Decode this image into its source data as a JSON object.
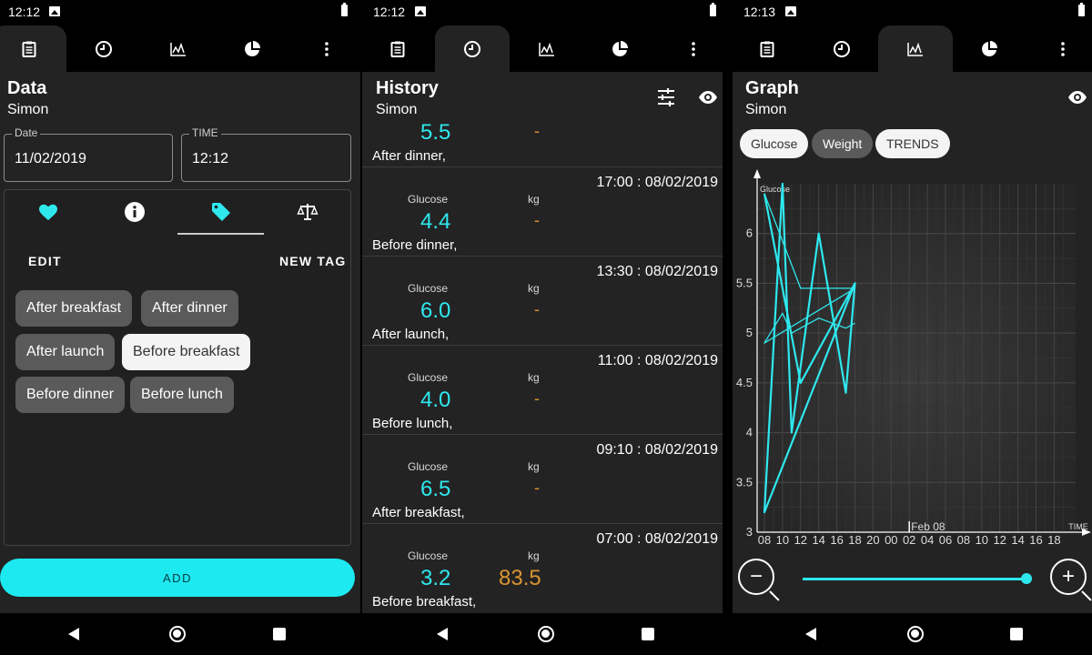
{
  "icons": {
    "tabs": [
      "data-entry-icon",
      "history-clock-icon",
      "graph-icon",
      "pie-chart-icon",
      "more-vert-icon"
    ],
    "status": [
      "image-notification-icon",
      "battery-icon"
    ],
    "nav": [
      "back-icon",
      "home-icon",
      "recents-icon"
    ]
  },
  "colors": {
    "accent": "#1de9f0",
    "glucose": "#2ee8ee",
    "weight": "#d99532",
    "background": "#232323"
  },
  "data_screen": {
    "status_time": "12:12",
    "active_tab": 0,
    "title": "Data",
    "user": "Simon",
    "date_label": "Date",
    "date_value": "11/02/2019",
    "time_label": "TIME",
    "time_value": "12:12",
    "card_tabs": [
      "heart-icon",
      "info-icon",
      "tag-icon",
      "scale-icon"
    ],
    "active_card_tab": 2,
    "edit_label": "EDIT",
    "new_tag_label": "NEW TAG",
    "tags": [
      {
        "label": "After breakfast",
        "selected": false
      },
      {
        "label": "After dinner",
        "selected": false
      },
      {
        "label": "After launch",
        "selected": false
      },
      {
        "label": "Before breakfast",
        "selected": true
      },
      {
        "label": "Before dinner",
        "selected": false
      },
      {
        "label": "Before lunch",
        "selected": false
      }
    ],
    "add_label": "ADD"
  },
  "history_screen": {
    "status_time": "12:12",
    "active_tab": 1,
    "title": "History",
    "user": "Simon",
    "header_icons": [
      "filter-sliders-icon",
      "visibility-eye-icon"
    ],
    "entries": [
      {
        "time": "",
        "glucose_label": "",
        "kg_label": "",
        "glucose": "5.5",
        "kg": "-",
        "tag": "After dinner,"
      },
      {
        "time": "17:00 : 08/02/2019",
        "glucose_label": "Glucose",
        "kg_label": "kg",
        "glucose": "4.4",
        "kg": "-",
        "tag": "Before dinner,"
      },
      {
        "time": "13:30 : 08/02/2019",
        "glucose_label": "Glucose",
        "kg_label": "kg",
        "glucose": "6.0",
        "kg": "-",
        "tag": "After launch,"
      },
      {
        "time": "11:00 : 08/02/2019",
        "glucose_label": "Glucose",
        "kg_label": "kg",
        "glucose": "4.0",
        "kg": "-",
        "tag": "Before lunch,"
      },
      {
        "time": "09:10 : 08/02/2019",
        "glucose_label": "Glucose",
        "kg_label": "kg",
        "glucose": "6.5",
        "kg": "-",
        "tag": "After breakfast,"
      },
      {
        "time": "07:00 : 08/02/2019",
        "glucose_label": "Glucose",
        "kg_label": "kg",
        "glucose": "3.2",
        "kg": "83.5",
        "tag": "Before breakfast,"
      }
    ]
  },
  "graph_screen": {
    "status_time": "12:13",
    "active_tab": 2,
    "title": "Graph",
    "user": "Simon",
    "header_icons": [
      "visibility-eye-icon"
    ],
    "chips": [
      {
        "label": "Glucose",
        "style": "light"
      },
      {
        "label": "Weight",
        "style": "dark"
      },
      {
        "label": "TRENDS",
        "style": "light"
      }
    ],
    "zoom_out": "−",
    "zoom_in": "+",
    "zoom_level": 1.0
  },
  "chart_data": {
    "type": "line",
    "title": "",
    "ylabel": "Glucose",
    "xlabel": "TIME",
    "ylim": [
      3,
      6.5
    ],
    "yticks": [
      "3",
      "3.5",
      "4",
      "4.5",
      "5",
      "5.5",
      "6"
    ],
    "xticks": [
      "08",
      "10",
      "12",
      "14",
      "16",
      "18",
      "20",
      "00",
      "02",
      "04",
      "06",
      "08",
      "10",
      "12",
      "14",
      "16",
      "18"
    ],
    "date_marker": "Feb 08",
    "grid": true,
    "legend": "none",
    "series": [
      {
        "x": [
          "08",
          "12",
          "18",
          "08",
          "10",
          "11",
          "14",
          "17",
          "18"
        ],
        "values": [
          6.4,
          4.5,
          5.5,
          3.2,
          6.5,
          4.0,
          6.0,
          4.4,
          5.5
        ]
      },
      {
        "x": [
          "08",
          "12",
          "18",
          "08",
          "10",
          "11",
          "14",
          "17",
          "18"
        ],
        "values": [
          6.4,
          5.45,
          5.45,
          4.9,
          5.2,
          5.0,
          5.15,
          5.05,
          5.1
        ]
      }
    ]
  }
}
